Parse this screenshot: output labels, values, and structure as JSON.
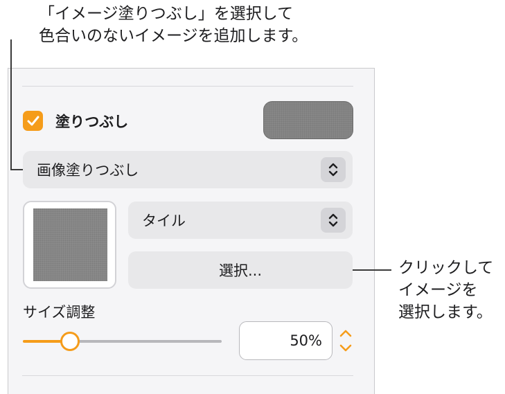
{
  "callouts": {
    "top_line1": "「イメージ塗りつぶし」を選択して",
    "top_line2": "色合いのないイメージを追加します。",
    "right_line1": "クリックして",
    "right_line2": "イメージを",
    "right_line3": "選択します。"
  },
  "fill": {
    "checked": true,
    "label": "塗りつぶし",
    "color_well_color": "#878787"
  },
  "fill_type_popup": {
    "selected": "画像塗りつぶし",
    "icon": "up-down-chevrons-icon"
  },
  "image_options": {
    "scale_mode_popup": {
      "selected": "タイル",
      "icon": "up-down-chevrons-icon"
    },
    "choose_button": "選択..."
  },
  "scale": {
    "label": "サイズ調整",
    "slider_value": 0.2,
    "value_text": "50%"
  },
  "colors": {
    "accent": "#f59c1a",
    "panel_bg": "#f5f5f7",
    "control_bg": "#e8e8ea"
  }
}
